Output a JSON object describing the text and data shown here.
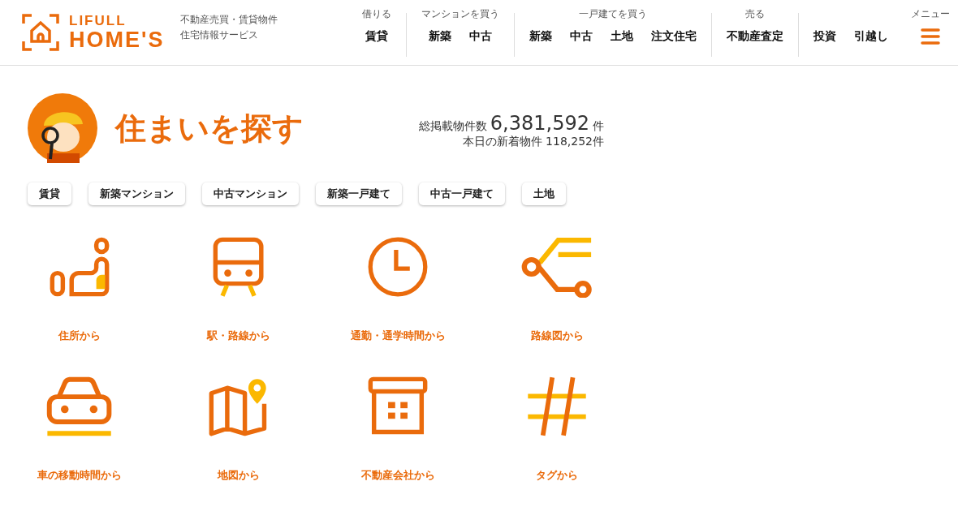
{
  "logo": {
    "top": "LIFULL",
    "bottom": "HOME'S"
  },
  "tagline": [
    "不動産売買・賃貸物件",
    "住宅情報サービス"
  ],
  "nav": [
    {
      "label": "借りる",
      "items": [
        "賃貸"
      ]
    },
    {
      "label": "マンションを買う",
      "items": [
        "新築",
        "中古"
      ]
    },
    {
      "label": "一戸建てを買う",
      "items": [
        "新築",
        "中古",
        "土地",
        "注文住宅"
      ]
    },
    {
      "label": "売る",
      "items": [
        "不動産査定"
      ]
    },
    {
      "items": [
        "投資",
        "引越し"
      ]
    }
  ],
  "menu": {
    "label": "メニュー"
  },
  "hero": {
    "title": "住まいを探す",
    "total_label": "総掲載物件数",
    "total_value": "6,381,592",
    "total_unit": "件",
    "new_label": "本日の新着物件",
    "new_value": "118,252件"
  },
  "categories": [
    "賃貸",
    "新築マンション",
    "中古マンション",
    "新築一戸建て",
    "中古一戸建て",
    "土地"
  ],
  "search_methods": [
    {
      "kind": "address",
      "label": "住所から"
    },
    {
      "kind": "station",
      "label": "駅・路線から"
    },
    {
      "kind": "commute",
      "label": "通勤・通学時間から"
    },
    {
      "kind": "route",
      "label": "路線図から"
    },
    {
      "kind": "car",
      "label": "車の移動時間から"
    },
    {
      "kind": "map",
      "label": "地図から"
    },
    {
      "kind": "company",
      "label": "不動産会社から"
    },
    {
      "kind": "tag",
      "label": "タグから"
    }
  ]
}
